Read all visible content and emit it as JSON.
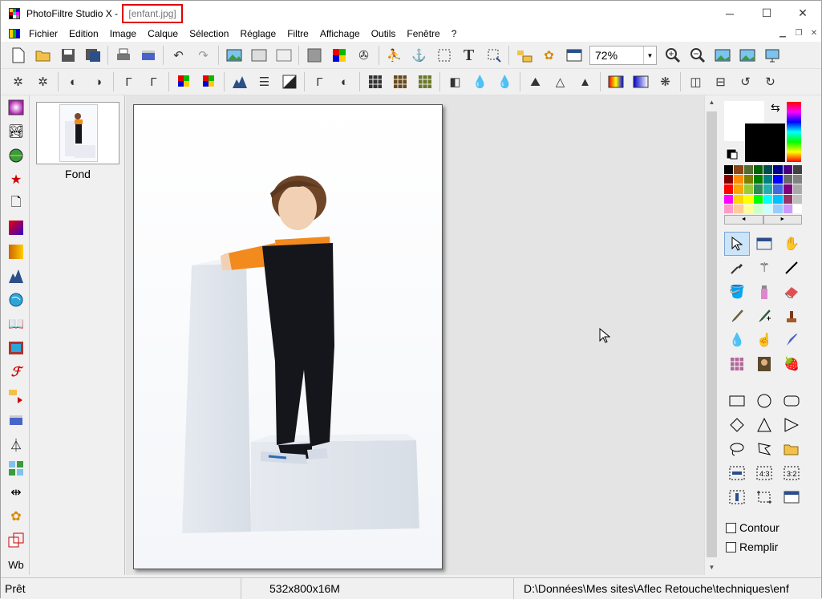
{
  "window": {
    "app_title": "PhotoFiltre Studio X - ",
    "file_title": "[enfant.jpg]",
    "minimize": "─",
    "maximize": "☐",
    "close": "✕"
  },
  "menu": {
    "items": [
      "Fichier",
      "Edition",
      "Image",
      "Calque",
      "Sélection",
      "Réglage",
      "Filtre",
      "Affichage",
      "Outils",
      "Fenêtre",
      "?"
    ],
    "mdi_min": "▁",
    "mdi_restore": "❐",
    "mdi_close": "✕"
  },
  "toolbar1": {
    "zoom_value": "72%",
    "zoom_arrow": "▼"
  },
  "layers": {
    "layer_name": "Fond"
  },
  "left_tools": {
    "wb_label": "Wb"
  },
  "right_panel": {
    "contour_label": "Contour",
    "remplir_label": "Remplir",
    "pal_prev": "◄",
    "pal_next": "►",
    "swap_icon": "⇆"
  },
  "scroll": {
    "up": "▲",
    "down": "▼"
  },
  "status": {
    "state": "Prêt",
    "dimensions": "532x800x16M",
    "path": "D:\\Données\\Mes sites\\Aflec Retouche\\techniques\\enf"
  },
  "colors": {
    "highlight_border": "#e00000",
    "child_shirt": "#f28a1e",
    "overalls": "#15161b"
  }
}
